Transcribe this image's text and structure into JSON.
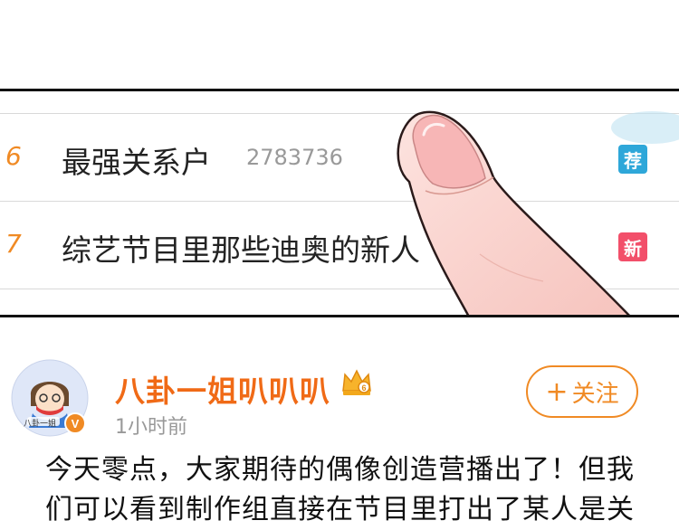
{
  "trending": [
    {
      "rank": "6",
      "title": "最强关系户",
      "count": "2783736",
      "badge": "荐",
      "badge_color": "#2ea7d9"
    },
    {
      "rank": "7",
      "title": "综艺节目里那些迪奥的新人",
      "count": "",
      "badge": "新",
      "badge_color": "#f24f6a"
    }
  ],
  "post": {
    "author": "八卦一姐叭叭叭",
    "time": "1小时前",
    "follow_label": "关注",
    "follow_icon": "plus-icon",
    "avatar_caption": "八卦一姐",
    "text_lines": [
      "今天零点，大家期待的偶像创造营播出了！但我",
      "们可以看到制作组直接在节目里打出了某人是关"
    ]
  },
  "colors": {
    "accent": "#f08a24",
    "author": "#f06a16"
  }
}
